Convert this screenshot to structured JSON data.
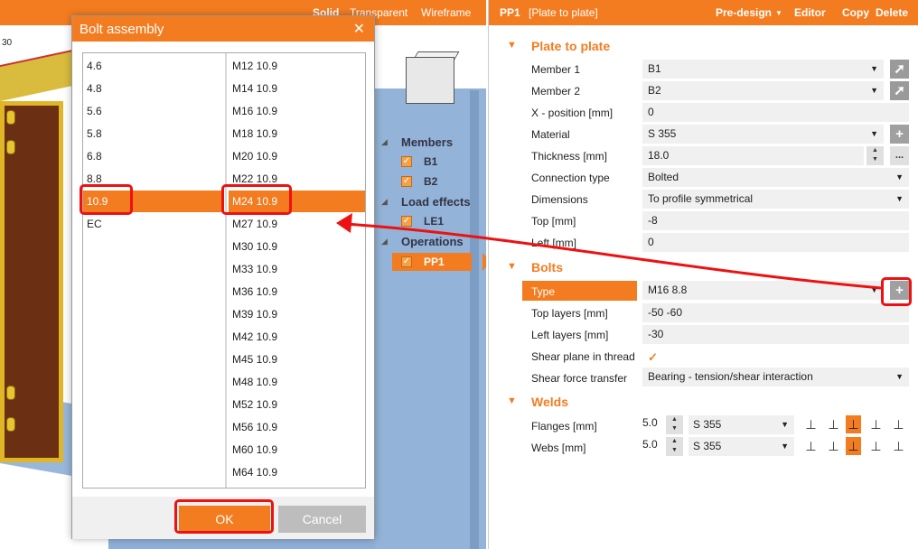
{
  "viewport": {
    "modes": [
      "Solid",
      "Transparent",
      "Wireframe"
    ],
    "scale_label": "30",
    "tree": {
      "members_header": "Members",
      "members": [
        "B1",
        "B2"
      ],
      "load_effects_header": "Load effects",
      "load_effects": [
        "LE1"
      ],
      "operations_header": "Operations",
      "operations": [
        "PP1"
      ]
    }
  },
  "dialog": {
    "title": "Bolt assembly",
    "close_icon": "close-icon",
    "grades": [
      "4.6",
      "4.8",
      "5.6",
      "5.8",
      "6.8",
      "8.8",
      "10.9",
      "EC"
    ],
    "selected_grade": "10.9",
    "sizes": [
      "M12 10.9",
      "M14 10.9",
      "M16 10.9",
      "M18 10.9",
      "M20 10.9",
      "M22 10.9",
      "M24 10.9",
      "M27 10.9",
      "M30 10.9",
      "M33 10.9",
      "M36 10.9",
      "M39 10.9",
      "M42 10.9",
      "M45 10.9",
      "M48 10.9",
      "M52 10.9",
      "M56 10.9",
      "M60 10.9",
      "M64 10.9"
    ],
    "selected_size": "M24 10.9",
    "ok_label": "OK",
    "cancel_label": "Cancel"
  },
  "panel": {
    "id": "PP1",
    "name": "[Plate to plate]",
    "toolbar": {
      "predesign": "Pre-design",
      "editor": "Editor",
      "copy": "Copy",
      "delete": "Delete"
    },
    "plate_section": "Plate to plate",
    "plate_rows": {
      "member1_label": "Member 1",
      "member1_value": "B1",
      "member2_label": "Member 2",
      "member2_value": "B2",
      "xpos_label": "X - position [mm]",
      "xpos_value": "0",
      "material_label": "Material",
      "material_value": "S 355",
      "thickness_label": "Thickness [mm]",
      "thickness_value": "18.0",
      "conn_label": "Connection type",
      "conn_value": "Bolted",
      "dim_label": "Dimensions",
      "dim_value": "To profile symmetrical",
      "top_label": "Top [mm]",
      "top_value": "-8",
      "left_label": "Left [mm]",
      "left_value": "0"
    },
    "bolts_section": "Bolts",
    "bolt_rows": {
      "type_label": "Type",
      "type_value": "M16 8.8",
      "toplayers_label": "Top layers [mm]",
      "toplayers_value": "-50 -60",
      "leftlayers_label": "Left layers [mm]",
      "leftlayers_value": "-30",
      "shear_thread_label": "Shear plane in thread",
      "shear_thread_checked": true,
      "shear_force_label": "Shear force transfer",
      "shear_force_value": "Bearing - tension/shear interaction"
    },
    "welds_section": "Welds",
    "weld_rows": {
      "flanges_label": "Flanges [mm]",
      "flanges_value": "5.0",
      "flanges_material": "S 355",
      "webs_label": "Webs [mm]",
      "webs_value": "5.0",
      "webs_material": "S 355"
    }
  },
  "colors": {
    "accent": "#f47c20",
    "annotation": "#e11111"
  }
}
